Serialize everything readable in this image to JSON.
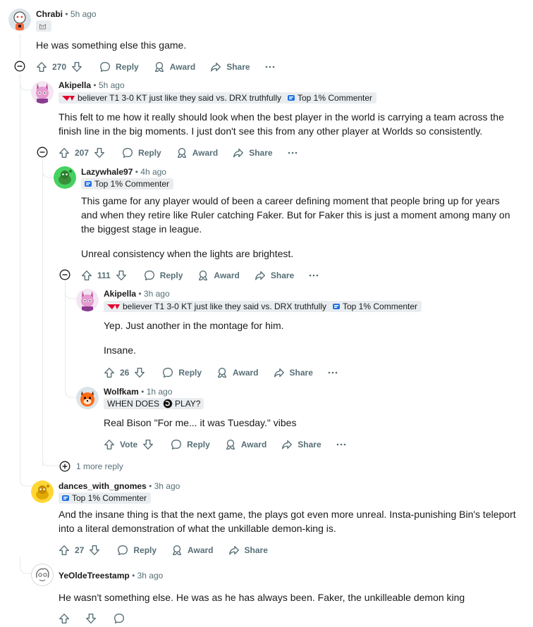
{
  "comments": [
    {
      "author": "Chrabi",
      "time": "5h ago",
      "body": [
        "He was something else this game."
      ],
      "score": "270",
      "reply": "Reply",
      "award": "Award",
      "share": "Share"
    },
    {
      "author": "Akipella",
      "time": "5h ago",
      "flair_user": "believer T1 3-0 KT just like they said vs. DRX truthfully",
      "flair_badge": "Top 1% Commenter",
      "body": [
        "This felt to me how it really should look when the best player in the world is carrying a team across the finish line in the big moments. I just don't see this from any other player at Worlds so consistently."
      ],
      "score": "207",
      "reply": "Reply",
      "award": "Award",
      "share": "Share"
    },
    {
      "author": "Lazywhale97",
      "time": "4h ago",
      "flair_badge": "Top 1% Commenter",
      "body": [
        "This game for any player would of been a career defining moment that people bring up for years and when they retire like Ruler catching Faker. But for Faker this is just a moment among many on the biggest stage in league.",
        "Unreal consistency when the lights are brightest."
      ],
      "score": "111",
      "reply": "Reply",
      "award": "Award",
      "share": "Share"
    },
    {
      "author": "Akipella",
      "time": "3h ago",
      "flair_user": "believer T1 3-0 KT just like they said vs. DRX truthfully",
      "flair_badge": "Top 1% Commenter",
      "body": [
        "Yep. Just another in the montage for him.",
        "Insane."
      ],
      "score": "26",
      "reply": "Reply",
      "award": "Award",
      "share": "Share"
    },
    {
      "author": "Wolfkam",
      "time": "1h ago",
      "flair_user_a": "WHEN DOES",
      "flair_user_b": "PLAY?",
      "body": [
        "Real Bison \"For me... it was Tuesday.\" vibes"
      ],
      "score": "Vote",
      "reply": "Reply",
      "award": "Award",
      "share": "Share"
    },
    {
      "author": "dances_with_gnomes",
      "time": "3h ago",
      "flair_badge": "Top 1% Commenter",
      "body": [
        "And the insane thing is that the next game, the plays got even more unreal. Insta-punishing Bin's teleport into a literal demonstration of what the unkillable demon-king is."
      ],
      "score": "27",
      "reply": "Reply",
      "award": "Award",
      "share": "Share"
    },
    {
      "author": "YeOldeTreestamp",
      "time": "3h ago",
      "body": [
        "He wasn't something else. He was as he has always been. Faker, the unkilleable demon king"
      ]
    }
  ],
  "more_replies": "1 more reply",
  "separator": "•",
  "colors": {
    "meta": "#576f76",
    "flair_bg": "#eaedef",
    "thread_line": "#e5ebee",
    "t1_red": "#e2012d"
  }
}
